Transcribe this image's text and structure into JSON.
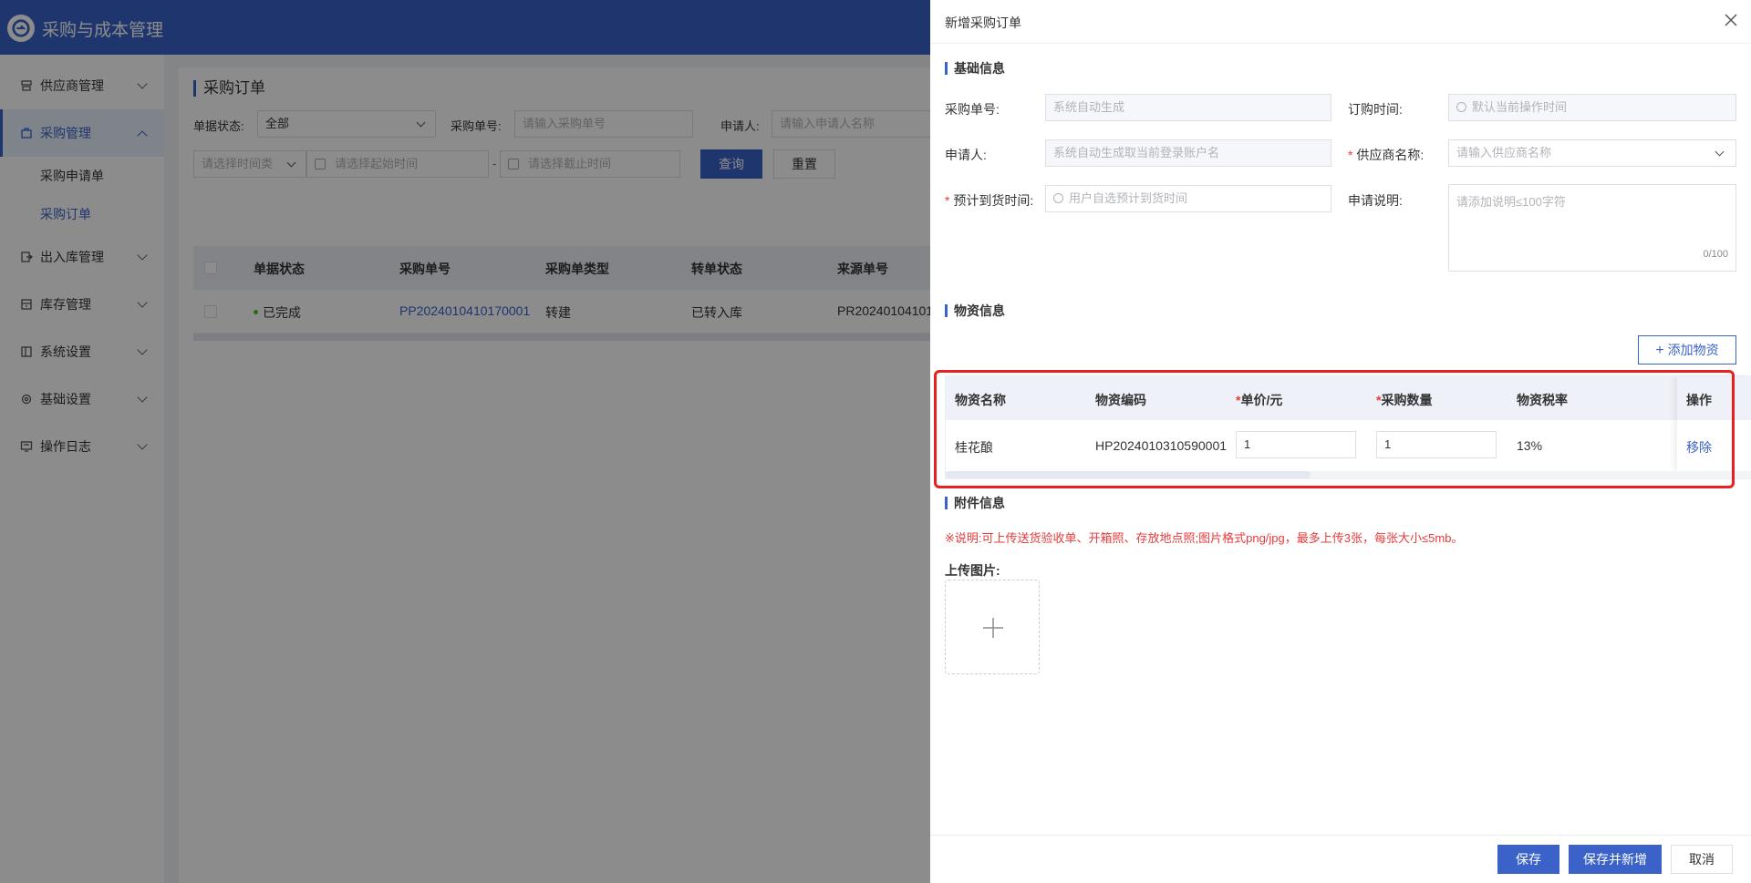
{
  "app": {
    "title": "采购与成本管理",
    "accent": "#3a62c8"
  },
  "sidebar": {
    "items": [
      {
        "label": "供应商管理"
      },
      {
        "label": "采购管理"
      },
      {
        "label": "出入库管理"
      },
      {
        "label": "库存管理"
      },
      {
        "label": "系统设置"
      },
      {
        "label": "基础设置"
      },
      {
        "label": "操作日志"
      }
    ],
    "sub_items": [
      {
        "label": "采购申请单"
      },
      {
        "label": "采购订单"
      }
    ]
  },
  "main": {
    "title": "采购订单",
    "filters": {
      "status_label": "单据状态:",
      "status_value": "全部",
      "order_no_label": "采购单号:",
      "order_no_placeholder": "请输入采购单号",
      "applicant_label": "申请人:",
      "applicant_placeholder": "请输入申请人名称",
      "time_type_placeholder": "请选择时间类",
      "start_placeholder": "请选择起始时间",
      "separator": "-",
      "end_placeholder": "请选择截止时间",
      "query_label": "查询",
      "reset_label": "重置"
    },
    "table": {
      "headers": [
        "单据状态",
        "采购单号",
        "采购单类型",
        "转单状态",
        "来源单号"
      ],
      "rows": [
        {
          "status": "已完成",
          "order_no": "PP2024010410170001",
          "type": "转建",
          "transfer": "已转入库",
          "source": "PR20240104101"
        }
      ]
    }
  },
  "drawer": {
    "title": "新增采购订单",
    "basic": {
      "section_title": "基础信息",
      "order_no_label": "采购单号:",
      "order_no_placeholder": "系统自动生成",
      "order_time_label": "订购时间:",
      "order_time_placeholder": "默认当前操作时间",
      "applicant_label": "申请人:",
      "applicant_placeholder": "系统自动生成取当前登录账户名",
      "supplier_label": "供应商名称:",
      "supplier_placeholder": "请输入供应商名称",
      "arrival_label": "预计到货时间:",
      "arrival_placeholder": "用户自选预计到货时间",
      "remark_label": "申请说明:",
      "remark_placeholder": "请添加说明≤100字符",
      "remark_counter": "0/100",
      "required_mark": "*"
    },
    "materials": {
      "section_title": "物资信息",
      "add_label": "添加物资",
      "headers": {
        "name": "物资名称",
        "code": "物资编码",
        "price": "单价/元",
        "qty": "采购数量",
        "tax": "物资税率",
        "op": "操作"
      },
      "rows": [
        {
          "name": "桂花酿",
          "code": "HP2024010310590001",
          "price": "1",
          "qty": "1",
          "tax": "13%",
          "op": "移除"
        }
      ]
    },
    "attachment": {
      "section_title": "附件信息",
      "note": "※说明:可上传送货验收单、开箱照、存放地点照;图片格式png/jpg，最多上传3张，每张大小≤5mb。",
      "upload_label": "上传图片:"
    },
    "footer": {
      "save_label": "保存",
      "save_new_label": "保存并新增",
      "cancel_label": "取消"
    }
  }
}
